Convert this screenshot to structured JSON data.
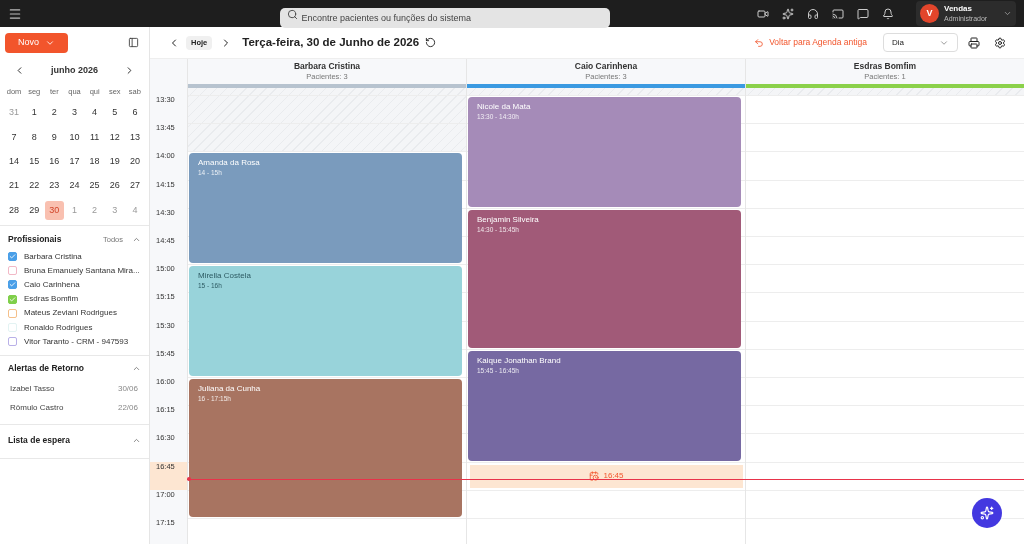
{
  "topbar": {
    "search": {
      "placeholder": "Encontre pacientes ou funções do sistema"
    },
    "user": {
      "initial": "V",
      "name": "Vendas",
      "role": "Administrador"
    }
  },
  "sidebar": {
    "new_button": "Novo",
    "calendar": {
      "month": "junho 2026",
      "weekdays": [
        "dom",
        "seg",
        "ter",
        "qua",
        "qui",
        "sex",
        "sab"
      ],
      "days": [
        {
          "label": "31",
          "outside": true,
          "selected": false
        },
        {
          "label": "1",
          "outside": false,
          "selected": false
        },
        {
          "label": "2",
          "outside": false,
          "selected": false
        },
        {
          "label": "3",
          "outside": false,
          "selected": false
        },
        {
          "label": "4",
          "outside": false,
          "selected": false
        },
        {
          "label": "5",
          "outside": false,
          "selected": false
        },
        {
          "label": "6",
          "outside": false,
          "selected": false
        },
        {
          "label": "7",
          "outside": false,
          "selected": false
        },
        {
          "label": "8",
          "outside": false,
          "selected": false
        },
        {
          "label": "9",
          "outside": false,
          "selected": false
        },
        {
          "label": "10",
          "outside": false,
          "selected": false
        },
        {
          "label": "11",
          "outside": false,
          "selected": false
        },
        {
          "label": "12",
          "outside": false,
          "selected": false
        },
        {
          "label": "13",
          "outside": false,
          "selected": false
        },
        {
          "label": "14",
          "outside": false,
          "selected": false
        },
        {
          "label": "15",
          "outside": false,
          "selected": false
        },
        {
          "label": "16",
          "outside": false,
          "selected": false
        },
        {
          "label": "17",
          "outside": false,
          "selected": false
        },
        {
          "label": "18",
          "outside": false,
          "selected": false
        },
        {
          "label": "19",
          "outside": false,
          "selected": false
        },
        {
          "label": "20",
          "outside": false,
          "selected": false
        },
        {
          "label": "21",
          "outside": false,
          "selected": false
        },
        {
          "label": "22",
          "outside": false,
          "selected": false
        },
        {
          "label": "23",
          "outside": false,
          "selected": false
        },
        {
          "label": "24",
          "outside": false,
          "selected": false
        },
        {
          "label": "25",
          "outside": false,
          "selected": false
        },
        {
          "label": "26",
          "outside": false,
          "selected": false
        },
        {
          "label": "27",
          "outside": false,
          "selected": false
        },
        {
          "label": "28",
          "outside": false,
          "selected": false
        },
        {
          "label": "29",
          "outside": false,
          "selected": false
        },
        {
          "label": "30",
          "outside": false,
          "selected": true
        },
        {
          "label": "1",
          "outside": true,
          "selected": false
        },
        {
          "label": "2",
          "outside": true,
          "selected": false
        },
        {
          "label": "3",
          "outside": true,
          "selected": false
        },
        {
          "label": "4",
          "outside": true,
          "selected": false
        }
      ]
    },
    "professionals": {
      "title": "Profissionais",
      "all_link": "Todos",
      "expanded": true,
      "items": [
        {
          "name": "Barbara Cristina",
          "checked": true,
          "color": "#4a9fe8"
        },
        {
          "name": "Bruna Emanuely Santana Mira...",
          "checked": false,
          "color": "#f2b8c6"
        },
        {
          "name": "Caio Carinhena",
          "checked": true,
          "color": "#4a9fe8"
        },
        {
          "name": "Esdras Bomfim",
          "checked": true,
          "color": "#7fcf4a"
        },
        {
          "name": "Mateus Zeviani Rodrigues",
          "checked": false,
          "color": "#f5c08a"
        },
        {
          "name": "Ronaldo Rodrigues",
          "checked": false,
          "color": "#e3f3f3"
        },
        {
          "name": "Vitor Taranto - CRM - 947593",
          "checked": false,
          "color": "#b9b0e8"
        }
      ]
    },
    "return_alerts": {
      "title": "Alertas de Retorno",
      "expanded": true,
      "items": [
        {
          "name": "Izabel Tasso",
          "date": "30/06"
        },
        {
          "name": "Rômulo Castro",
          "date": "22/06"
        }
      ]
    },
    "waitlist": {
      "title": "Lista de espera",
      "expanded": true
    }
  },
  "toolbar": {
    "today": "Hoje",
    "date_title": "Terça-feira, 30 de Junho de 2026",
    "old_agenda_link": "Voltar para Agenda antiga",
    "view_select": "Dia"
  },
  "schedule": {
    "times": [
      "13:30",
      "13:45",
      "14:00",
      "14:15",
      "14:30",
      "14:45",
      "15:00",
      "15:15",
      "15:30",
      "15:45",
      "16:00",
      "16:15",
      "16:30",
      "16:45",
      "17:00",
      "17:15"
    ],
    "columns": [
      {
        "name": "Barbara Cristina",
        "patients": "Pacientes: 3",
        "color": "#b7c3cf",
        "appointments": [
          {
            "patient": "Amanda da Rosa",
            "time": "14 - 15h",
            "color": "#7a9bbd"
          },
          {
            "patient": "Mirella Costela",
            "time": "15 - 16h",
            "color": "#98d3da"
          },
          {
            "patient": "Juliana da Cunha",
            "time": "16 - 17:15h",
            "color": "#a87461"
          }
        ]
      },
      {
        "name": "Caio Carinhena",
        "patients": "Pacientes: 3",
        "color": "#3b9ae1",
        "now_chip": "16:45",
        "appointments": [
          {
            "patient": "Nicole da Mata",
            "time": "13:30 - 14:30h",
            "color": "#a58bb8"
          },
          {
            "patient": "Benjamin Silveira",
            "time": "14:30 - 15:45h",
            "color": "#a15a78"
          },
          {
            "patient": "Kaique Jonathan Brand",
            "time": "15:45 - 16:45h",
            "color": "#7669a2"
          }
        ]
      },
      {
        "name": "Esdras Bomfim",
        "patients": "Pacientes: 1",
        "color": "#8bd14a"
      }
    ]
  }
}
